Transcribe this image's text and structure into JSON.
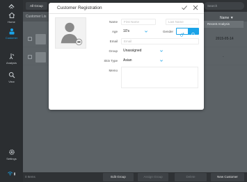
{
  "sidebar": {
    "items": [
      {
        "label": "Home"
      },
      {
        "label": "Customer"
      },
      {
        "label": "Analysis"
      },
      {
        "label": "View"
      },
      {
        "label": "Settings"
      }
    ]
  },
  "topbar": {
    "group_tab": "All Group",
    "search_placeholder": "Search"
  },
  "list": {
    "header_label": "Customer Lis",
    "sort_label": "Name ▼",
    "column_header": "Recent Analysis",
    "rows": [
      {
        "date": "2015-05-14"
      },
      {
        "date": "-"
      }
    ]
  },
  "bottombar": {
    "left_label": "0 Items",
    "edit_group": "Edit Group",
    "assign_group": "Assign Group",
    "delete": "Delete",
    "new_customer": "New Customer"
  },
  "modal": {
    "title": "Customer Registration",
    "fields": {
      "name_label": "Name",
      "first_name_placeholder": "First Name",
      "last_name_placeholder": "Last Name",
      "age_label": "Age",
      "age_value": "10's",
      "gender_label": "Gender",
      "email_label": "Email",
      "email_placeholder": "Email",
      "group_label": "Group",
      "group_value": "Unassigned",
      "skin_type_label": "Skin Type",
      "skin_type_value": "Asian",
      "memo_label": "Memo"
    }
  },
  "colors": {
    "accent": "#1aa3e8",
    "sidebar_bg": "#2b2e31",
    "modal_bg": "#ffffff"
  }
}
